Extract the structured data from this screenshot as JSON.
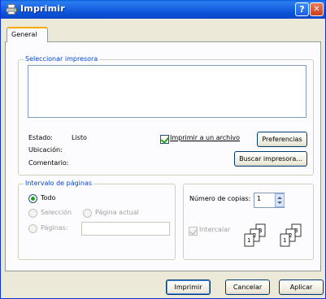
{
  "window": {
    "title": "Imprimir",
    "help_glyph": "?",
    "close_glyph": "✕"
  },
  "tabs": [
    {
      "label": "General"
    }
  ],
  "select_printer": {
    "legend": "Seleccionar impresora",
    "status_label": "Estado:",
    "status_value": "Listo",
    "location_label": "Ubicación:",
    "comment_label": "Comentario:",
    "print_to_file": {
      "label": "Imprimir a un archivo",
      "checked": true
    },
    "preferences_button": "Preferencias",
    "find_printer_button": "Buscar impresora..."
  },
  "page_range": {
    "legend": "Intervalo de páginas",
    "all": {
      "label": "Todo",
      "selected": true
    },
    "selection": {
      "label": "Selección",
      "enabled": false
    },
    "current_page": {
      "label": "Página actual",
      "enabled": false
    },
    "pages": {
      "label": "Páginas:",
      "enabled": false,
      "value": ""
    }
  },
  "copies": {
    "label": "Número de copias:",
    "value": "1",
    "collate": {
      "label": "Intercalar",
      "checked": true,
      "enabled": false
    }
  },
  "footer": {
    "print_button": "Imprimir",
    "cancel_button": "Cancelar",
    "apply_button": "Aplicar"
  },
  "icons": {
    "window": "printer-icon",
    "collate": "collate-pages-icon"
  },
  "colors": {
    "titlebar": "#0b52d6",
    "group_legend": "#0046d5",
    "check_mark": "#21a121",
    "tab_highlight": "#f8a800"
  }
}
